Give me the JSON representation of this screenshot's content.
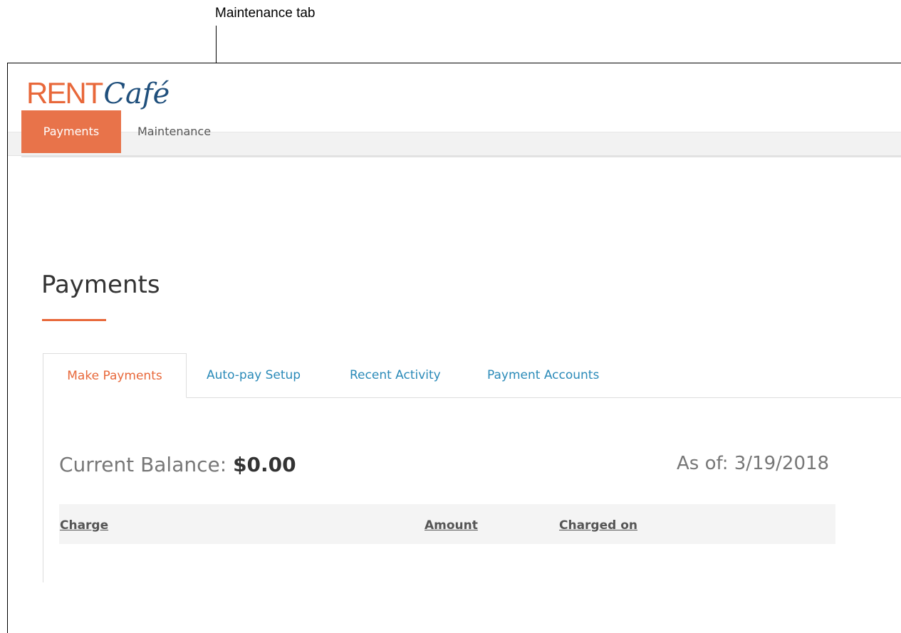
{
  "callout": {
    "label": "Maintenance tab"
  },
  "header": {
    "logo_rent": "RENT",
    "logo_cafe": "Café"
  },
  "topnav": {
    "payments": "Payments",
    "maintenance": "Maintenance"
  },
  "page": {
    "title": "Payments"
  },
  "subtabs": {
    "make_payments": "Make Payments",
    "autopay_setup": "Auto-pay Setup",
    "recent_activity": "Recent Activity",
    "payment_accounts": "Payment Accounts"
  },
  "balance": {
    "label": "Current Balance: ",
    "amount": "$0.00",
    "as_of": "As of: 3/19/2018"
  },
  "table": {
    "columns": [
      "Charge",
      "Amount",
      "Charged on"
    ]
  },
  "colors": {
    "brand_orange": "#e8683a",
    "brand_blue": "#1f4f7c",
    "link_blue": "#2a8ab8"
  }
}
